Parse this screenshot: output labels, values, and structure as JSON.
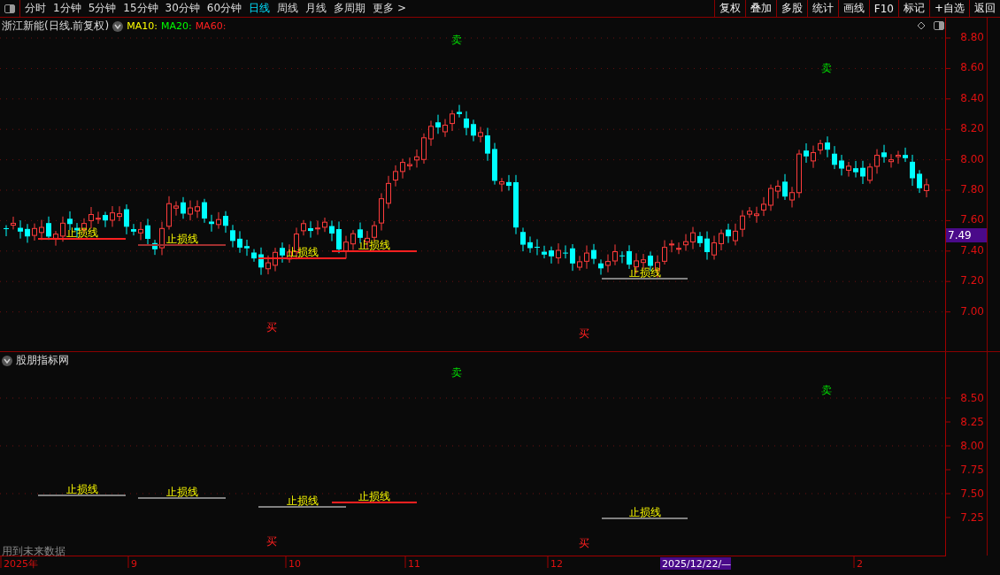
{
  "toolbar": {
    "periods": [
      {
        "label": "分时",
        "selected": false
      },
      {
        "label": "1分钟",
        "selected": false
      },
      {
        "label": "5分钟",
        "selected": false
      },
      {
        "label": "15分钟",
        "selected": false
      },
      {
        "label": "30分钟",
        "selected": false
      },
      {
        "label": "60分钟",
        "selected": false
      },
      {
        "label": "日线",
        "selected": true
      },
      {
        "label": "周线",
        "selected": false
      },
      {
        "label": "月线",
        "selected": false
      },
      {
        "label": "多周期",
        "selected": false
      }
    ],
    "more": "更多 >",
    "buttons": [
      "复权",
      "叠加",
      "多股",
      "统计",
      "画线",
      "F10",
      "标记",
      "+自选",
      "返回"
    ]
  },
  "main_chart": {
    "title": "浙江新能(日线.前复权)",
    "ma": [
      {
        "label": "MA10:",
        "color": "#ffff00"
      },
      {
        "label": "MA20:",
        "color": "#00ff00"
      },
      {
        "label": "MA60:",
        "color": "#ff2020"
      }
    ],
    "y_labels": [
      "8.80",
      "8.60",
      "8.40",
      "8.20",
      "8.00",
      "7.80",
      "7.60",
      "7.40",
      "7.20",
      "7.00"
    ],
    "price_tag": "7.49",
    "signals": [
      {
        "kind": "sell",
        "label": "卖"
      },
      {
        "kind": "sell",
        "label": "卖"
      },
      {
        "kind": "buy",
        "label": "买"
      },
      {
        "kind": "buy",
        "label": "买"
      }
    ],
    "stop_lines": [
      {
        "label": "止损线",
        "color": "#ff2020"
      },
      {
        "label": "止损线",
        "color": "#a03030"
      },
      {
        "label": "止损线",
        "color": "#ff2020"
      },
      {
        "label": "止损线",
        "color": "#ff2020"
      },
      {
        "label": "止损线",
        "color": "#808080"
      }
    ]
  },
  "sub_chart": {
    "title": "股朋指标网",
    "y_labels": [
      "8.50",
      "8.25",
      "8.00",
      "7.75",
      "7.50",
      "7.25"
    ],
    "signals": [
      {
        "kind": "sell",
        "label": "卖"
      },
      {
        "kind": "sell",
        "label": "卖"
      },
      {
        "kind": "buy",
        "label": "买"
      },
      {
        "kind": "buy",
        "label": "买"
      }
    ],
    "stop_lines": [
      {
        "label": "止损线",
        "color": "#808080"
      },
      {
        "label": "止损线",
        "color": "#808080"
      },
      {
        "label": "止损线",
        "color": "#808080"
      },
      {
        "label": "止损线",
        "color": "#ff2020"
      },
      {
        "label": "止损线",
        "color": "#808080"
      }
    ],
    "note": "用到未来数据"
  },
  "time_axis": {
    "labels": [
      "2025年",
      "9",
      "10",
      "11",
      "12",
      "2"
    ],
    "cursor_label": "2025/12/22/—"
  }
}
